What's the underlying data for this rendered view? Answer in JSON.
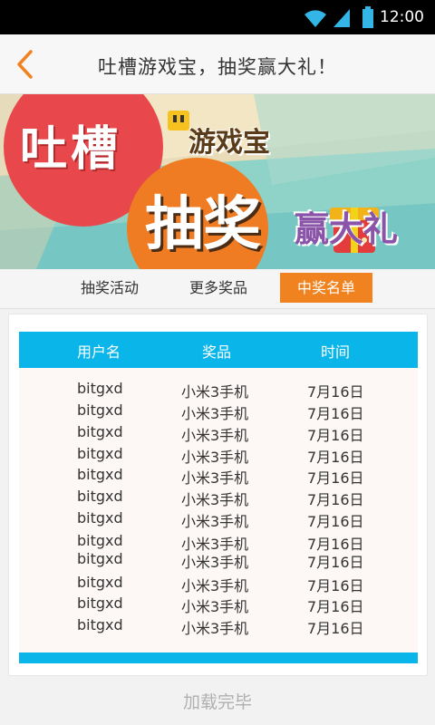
{
  "status_bar": {
    "time": "12:00"
  },
  "header": {
    "title": "吐槽游戏宝，抽奖赢大礼！"
  },
  "banner": {
    "text_tucao": "吐槽",
    "text_youxibao": "游戏宝",
    "text_choujiang": "抽奖",
    "text_yingdali": "赢大礼"
  },
  "tabs": [
    {
      "label": "抽奖活动"
    },
    {
      "label": "更多奖品"
    },
    {
      "label": "中奖名单"
    }
  ],
  "table": {
    "columns": [
      "用户名",
      "奖品",
      "时间"
    ],
    "rows": [
      [
        "bitgxd",
        "小米3手机",
        "7月16日"
      ],
      [
        "bitgxd",
        "小米3手机",
        "7月16日"
      ],
      [
        "bitgxd",
        "小米3手机",
        "7月16日"
      ],
      [
        "bitgxd",
        "小米3手机",
        "7月16日"
      ],
      [
        "bitgxd",
        "小米3手机",
        "7月16日"
      ],
      [
        "bitgxd",
        "小米3手机",
        "7月16日"
      ],
      [
        "bitgxd",
        "小米3手机",
        "7月16日"
      ],
      [
        "bitgxd",
        "小米3手机",
        "7月16日"
      ],
      [
        "bitgxd",
        "小米3手机",
        "7月16日"
      ],
      [
        "bitgxd",
        "小米3手机",
        "7月16日"
      ],
      [
        "bitgxd",
        "小米3手机",
        "7月16日"
      ],
      [
        "bitgxd",
        "小米3手机",
        "7月16日"
      ]
    ]
  },
  "footer": {
    "text": "加载完毕"
  },
  "colors": {
    "accent": "#f0821f",
    "table_header": "#0ab6e9",
    "back_arrow": "#f0821f"
  }
}
